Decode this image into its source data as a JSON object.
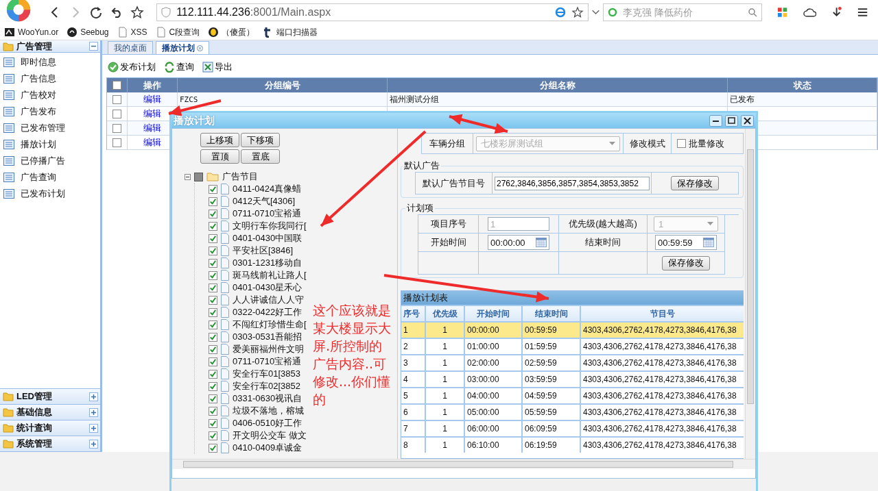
{
  "browser": {
    "address_host": "112.111.44.236",
    "address_path": ":8001/Main.aspx",
    "search_placeholder": "李克强 降低药价",
    "bookmarks": [
      {
        "label": "WooYun.or"
      },
      {
        "label": "Seebug"
      },
      {
        "label": "XSS"
      },
      {
        "label": "C段查询"
      },
      {
        "label": "（傻蛋）"
      },
      {
        "label": "端口扫描器"
      }
    ]
  },
  "sidebar": {
    "sections": [
      {
        "title": "广告管理",
        "expanded": true,
        "items": [
          "即时信息",
          "广告信息",
          "广告校对",
          "广告发布",
          "已发布管理",
          "播放计划",
          "已停播广告",
          "广告查询",
          "已发布计划"
        ]
      },
      {
        "title": "LED管理",
        "expanded": false
      },
      {
        "title": "基础信息",
        "expanded": false
      },
      {
        "title": "统计查询",
        "expanded": false
      },
      {
        "title": "系统管理",
        "expanded": false
      }
    ]
  },
  "tabs": [
    {
      "label": "我的桌面",
      "selected": false,
      "closable": false
    },
    {
      "label": "播放计划",
      "selected": true,
      "closable": true
    }
  ],
  "toolbar": [
    "发布计划",
    "查询",
    "导出"
  ],
  "table": {
    "header_checked": false,
    "columns": [
      "操作",
      "分组编号",
      "分组名称",
      "状态"
    ],
    "rows": [
      {
        "checked": false,
        "action": "编辑",
        "code": "FZCS",
        "name": "福州测试分组",
        "status": "已发布"
      },
      {
        "checked": false,
        "action": "编辑"
      },
      {
        "checked": false,
        "action": "编辑"
      },
      {
        "checked": false,
        "action": "编辑"
      }
    ]
  },
  "dialog": {
    "title": "播放计划",
    "tree_buttons": [
      "上移项",
      "下移项",
      "置顶",
      "置底"
    ],
    "tree": {
      "label": "广告节目",
      "expanded": true,
      "partial": true,
      "children": [
        {
          "label": "0411-0424真像蜡",
          "checked": true
        },
        {
          "label": "0412天气[4306]",
          "checked": true
        },
        {
          "label": "0711-0710宝裕通",
          "checked": true
        },
        {
          "label": "文明行车你我同行[",
          "checked": true
        },
        {
          "label": "0401-0430中国联",
          "checked": true
        },
        {
          "label": "平安社区[3846]",
          "checked": true
        },
        {
          "label": "0301-1231移动自",
          "checked": true
        },
        {
          "label": "斑马线前礼让路人[",
          "checked": true
        },
        {
          "label": "0401-0430星禾心",
          "checked": true
        },
        {
          "label": "人人讲诚信人人守",
          "checked": true
        },
        {
          "label": "0322-0422好工作",
          "checked": true
        },
        {
          "label": "不闯红灯珍惜生命[",
          "checked": true
        },
        {
          "label": "0303-0531吾能招",
          "checked": true
        },
        {
          "label": "爱美丽福州件文明",
          "checked": true
        },
        {
          "label": "0711-0710宝裕通",
          "checked": true
        },
        {
          "label": "安全行车01[3853",
          "checked": true
        },
        {
          "label": "安全行车02[3852",
          "checked": true
        },
        {
          "label": "0331-0630视讯自",
          "checked": true
        },
        {
          "label": "垃圾不落地，榕城",
          "checked": true
        },
        {
          "label": "0406-0510好工作",
          "checked": true
        },
        {
          "label": "开文明公交车 做文",
          "checked": true
        },
        {
          "label": "0410-0409卓诚金",
          "checked": true
        }
      ]
    },
    "group_label": "车辆分组",
    "group_value": "七楼彩屏测试组",
    "mode_label": "修改模式",
    "batch_label": "批量修改",
    "batch_checked": false,
    "default_legend": "默认广告",
    "default_label": "默认广告节目号",
    "default_value": "2762,3846,3856,3857,3854,3853,3852",
    "default_save": "保存修改",
    "plan_legend": "计划项",
    "item_label": "项目序号",
    "item_value": "1",
    "priority_label": "优先级(越大越高)",
    "priority_value": "1",
    "start_label": "开始时间",
    "start_value": "00:00:00",
    "end_label": "结束时间",
    "end_value": "00:59:59",
    "plan_save": "保存修改",
    "grid": {
      "title": "播放计划表",
      "columns": [
        "序号",
        "优先级",
        "开始时间",
        "结束时间",
        "节目号"
      ],
      "rows": [
        {
          "selected": true,
          "cells": [
            "1",
            "1",
            "00:00:00",
            "00:59:59",
            "4303,4306,2762,4178,4273,3846,4176,38"
          ]
        },
        {
          "selected": false,
          "cells": [
            "2",
            "1",
            "01:00:00",
            "01:59:59",
            "4303,4306,2762,4178,4273,3846,4176,38"
          ]
        },
        {
          "selected": false,
          "cells": [
            "3",
            "1",
            "02:00:00",
            "02:59:59",
            "4303,4306,2762,4178,4273,3846,4176,38"
          ]
        },
        {
          "selected": false,
          "cells": [
            "4",
            "1",
            "03:00:00",
            "03:59:59",
            "4303,4306,2762,4178,4273,3846,4176,38"
          ]
        },
        {
          "selected": false,
          "cells": [
            "5",
            "1",
            "04:00:00",
            "04:59:59",
            "4303,4306,2762,4178,4273,3846,4176,38"
          ]
        },
        {
          "selected": false,
          "cells": [
            "6",
            "1",
            "05:00:00",
            "05:59:59",
            "4303,4306,2762,4178,4273,3846,4176,38"
          ]
        },
        {
          "selected": false,
          "cells": [
            "7",
            "1",
            "06:00:00",
            "06:09:59",
            "4303,4306,2762,4178,4273,3846,4176,38"
          ]
        },
        {
          "selected": false,
          "cells": [
            "8",
            "1",
            "06:10:00",
            "06:19:59",
            "4303,4306,2762,4178,4273,3846,4176,38"
          ]
        }
      ]
    }
  },
  "annotation": "这个应该就是某大楼显示大屏.所控制的广告内容..可修改...你们懂的"
}
